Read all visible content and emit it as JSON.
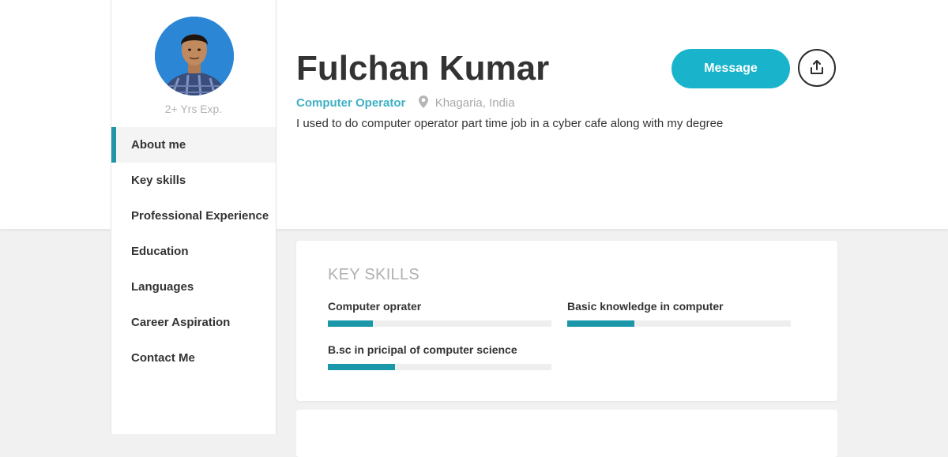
{
  "profile": {
    "name": "Fulchan Kumar",
    "experience": "2+ Yrs Exp.",
    "job_title": "Computer Operator",
    "location": "Khagaria, India",
    "bio": "I used to do computer operator part time job in a cyber cafe along with my degree",
    "avatar_icon": "profile-photo"
  },
  "actions": {
    "message_label": "Message",
    "share_icon": "share-upload-icon"
  },
  "nav": {
    "items": [
      {
        "label": "About me",
        "active": true
      },
      {
        "label": "Key skills",
        "active": false
      },
      {
        "label": "Professional Experience",
        "active": false
      },
      {
        "label": "Education",
        "active": false
      },
      {
        "label": "Languages",
        "active": false
      },
      {
        "label": "Career Aspiration",
        "active": false
      },
      {
        "label": "Contact Me",
        "active": false
      }
    ]
  },
  "key_skills": {
    "title": "KEY SKILLS",
    "skills": [
      {
        "name": "Computer oprater",
        "level": 0.2
      },
      {
        "name": "Basic knowledge in computer",
        "level": 0.3
      },
      {
        "name": "B.sc in pricipal of computer science",
        "level": 0.3
      }
    ]
  },
  "colors": {
    "accent": "#19b4cb",
    "skill_bar": "#1a97a9",
    "active_marker": "#2196a6",
    "job_title": "#3fb0c4"
  }
}
